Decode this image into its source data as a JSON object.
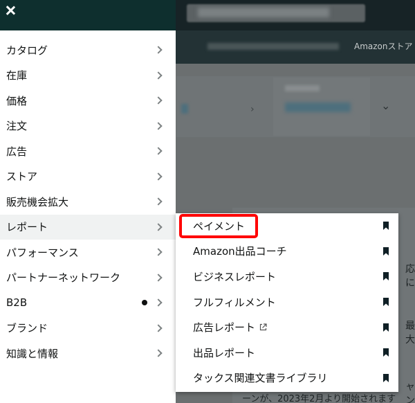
{
  "background": {
    "nav_text": "Amazonストア",
    "bottom_text": "ーンが、2023年2月より開始されます",
    "right_frag1": "応に",
    "right_frag2": "最大",
    "right_frag3": "ャン"
  },
  "drawer": {
    "menu": [
      {
        "label": "カタログ"
      },
      {
        "label": "在庫"
      },
      {
        "label": "価格"
      },
      {
        "label": "注文"
      },
      {
        "label": "広告"
      },
      {
        "label": "ストア"
      },
      {
        "label": "販売機会拡大"
      },
      {
        "label": "レポート"
      },
      {
        "label": "パフォーマンス"
      },
      {
        "label": "パートナーネットワーク"
      },
      {
        "label": "B2B"
      },
      {
        "label": "ブランド"
      },
      {
        "label": "知識と情報"
      }
    ]
  },
  "submenu": {
    "items": [
      {
        "label": "ペイメント"
      },
      {
        "label": "Amazon出品コーチ"
      },
      {
        "label": "ビジネスレポート"
      },
      {
        "label": "フルフィルメント"
      },
      {
        "label": "広告レポート"
      },
      {
        "label": "出品レポート"
      },
      {
        "label": "タックス関連文書ライブラリ"
      }
    ]
  },
  "colors": {
    "header_bg": "#0e2f2e",
    "highlight": "#ff0000",
    "active_row": "#f0f2f2"
  }
}
